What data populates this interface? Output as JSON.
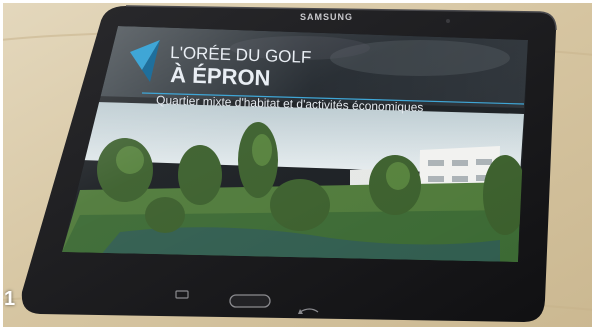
{
  "photo_number": "1",
  "tablet": {
    "brand": "SAMSUNG"
  },
  "screen": {
    "title_line1": "L'ORÉE DU GOLF",
    "title_line2": "À ÉPRON",
    "subtitle": "Quartier mixte d'habitat et d'activités économiques"
  },
  "colors": {
    "table": "#d8c9a8",
    "tablet_body": "#1c1c1e",
    "title_text": "#e9eef4",
    "accent_blue": "#3fa6d6",
    "screen_header": "#2a3036"
  },
  "icons": {
    "logo": "blue-arrow-logo",
    "recent_apps": "recent-apps-icon",
    "home_button": "home-button",
    "back": "back-icon"
  }
}
